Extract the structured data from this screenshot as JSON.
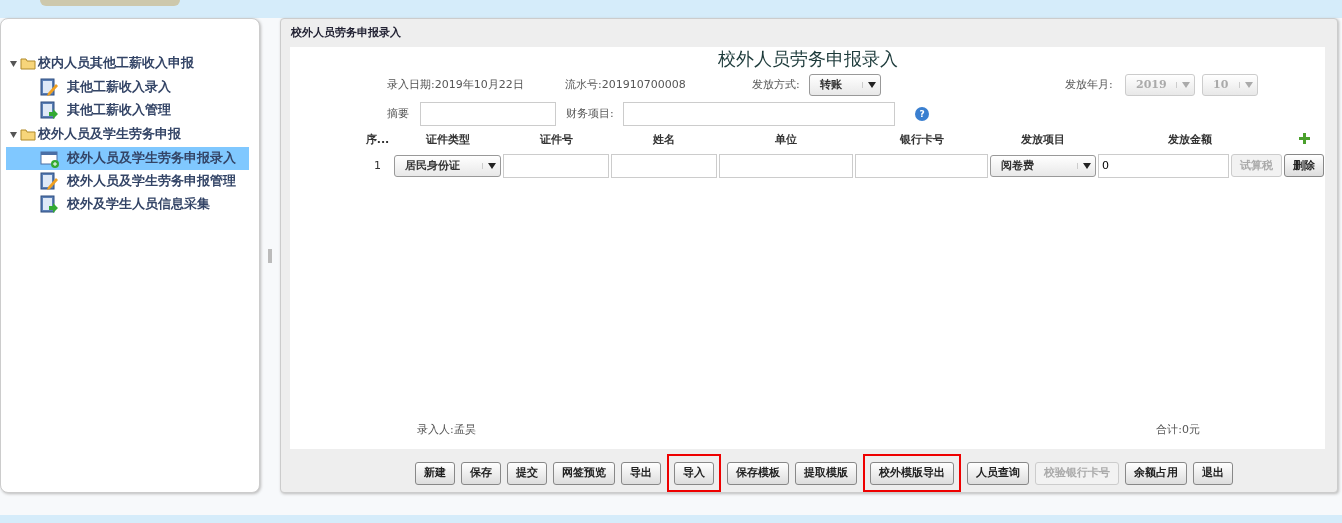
{
  "sidebar": {
    "groups": [
      {
        "label": "校内人员其他工薪收入申报",
        "expanded": true,
        "children": [
          {
            "label": "其他工薪收入录入",
            "kind": "edit",
            "selected": false
          },
          {
            "label": "其他工薪收入管理",
            "kind": "export",
            "selected": false
          }
        ]
      },
      {
        "label": "校外人员及学生劳务申报",
        "expanded": true,
        "children": [
          {
            "label": "校外人员及学生劳务申报录入",
            "kind": "add",
            "selected": true
          },
          {
            "label": "校外人员及学生劳务申报管理",
            "kind": "edit",
            "selected": false
          },
          {
            "label": "校外及学生人员信息采集",
            "kind": "export",
            "selected": false
          }
        ]
      }
    ]
  },
  "panel": {
    "title": "校外人员劳务申报录入"
  },
  "form": {
    "title": "校外人员劳务申报录入",
    "entry_date": "录入日期:2019年10月22日",
    "serial_no": "流水号:201910700008",
    "pay_method": {
      "label": "发放方式:",
      "value": "转账",
      "disabled": false
    },
    "pay_period": {
      "label": "发放年月:",
      "year": "2019",
      "month": "10",
      "disabled": true
    },
    "summary": {
      "label": "摘要"
    },
    "finance_item": {
      "label": "财务项目:"
    },
    "help_icon": "?"
  },
  "table": {
    "columns": [
      "序...",
      "证件类型",
      "证件号",
      "姓名",
      "单位",
      "银行卡号",
      "发放项目",
      "发放金额"
    ],
    "rows": [
      {
        "index": "1",
        "id_type": "居民身份证",
        "item": "阅卷费",
        "amount": "0",
        "calc_button": {
          "label": "试算税",
          "disabled": true
        },
        "delete_button": {
          "label": "删除",
          "disabled": false
        }
      }
    ]
  },
  "footer": {
    "entered_by": "录入人:孟昊",
    "total": "合计:0元"
  },
  "buttons": [
    {
      "label": "新建",
      "disabled": false,
      "highlighted": false
    },
    {
      "label": "保存",
      "disabled": false,
      "highlighted": false
    },
    {
      "label": "提交",
      "disabled": false,
      "highlighted": false
    },
    {
      "label": "网签预览",
      "disabled": false,
      "highlighted": false
    },
    {
      "label": "导出",
      "disabled": false,
      "highlighted": false
    },
    {
      "label": "导入",
      "disabled": false,
      "highlighted": true
    },
    {
      "label": "保存模板",
      "disabled": false,
      "highlighted": false
    },
    {
      "label": "提取模版",
      "disabled": false,
      "highlighted": false
    },
    {
      "label": "校外模版导出",
      "disabled": false,
      "highlighted": true
    },
    {
      "label": "人员查询",
      "disabled": false,
      "highlighted": false
    },
    {
      "label": "校验银行卡号",
      "disabled": true,
      "highlighted": false
    },
    {
      "label": "余额占用",
      "disabled": false,
      "highlighted": false
    },
    {
      "label": "退出",
      "disabled": false,
      "highlighted": false
    }
  ]
}
